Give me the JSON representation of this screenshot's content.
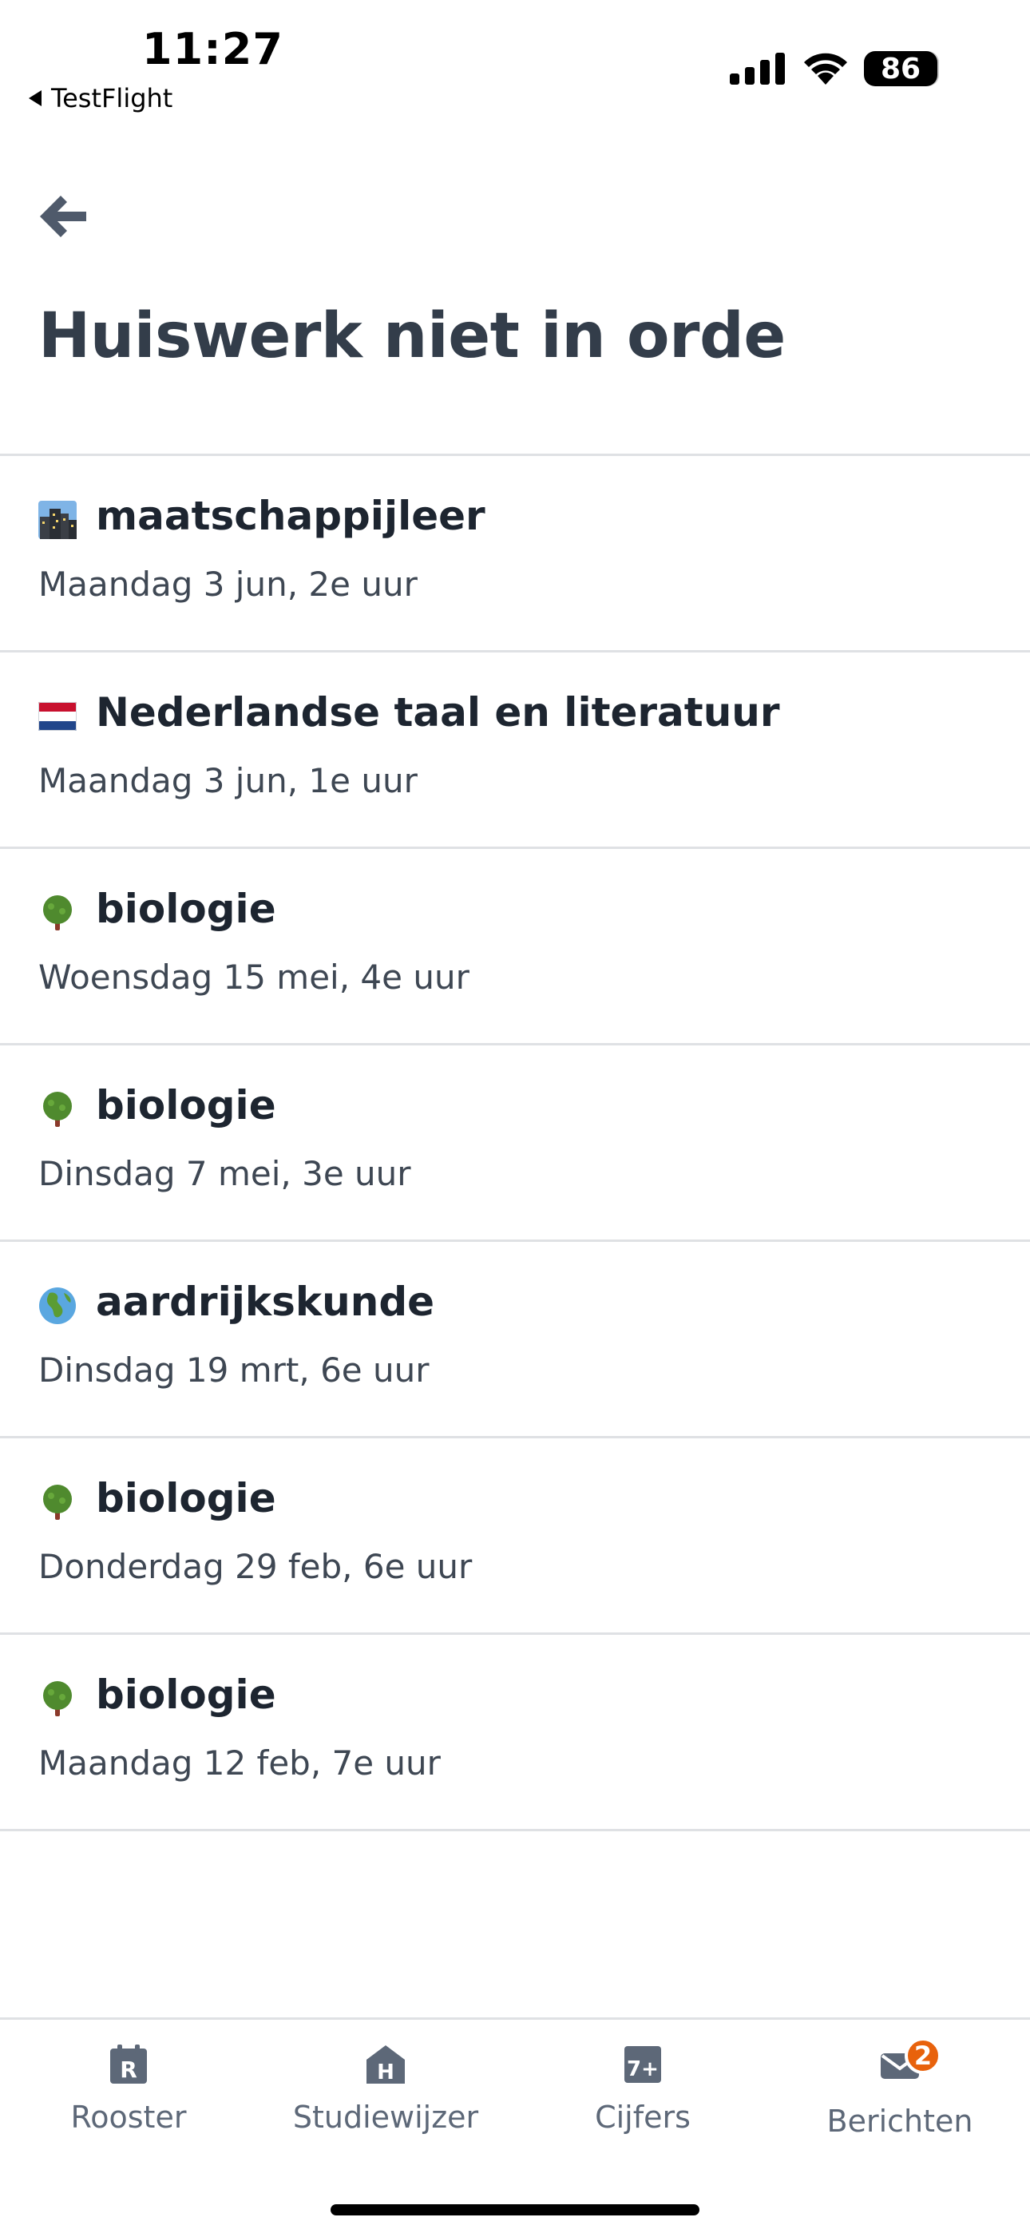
{
  "status_bar": {
    "time": "11:27",
    "back_app": "TestFlight",
    "battery": "86"
  },
  "header": {
    "back_icon": "arrow-left-icon",
    "title": "Huiswerk niet in orde"
  },
  "items": [
    {
      "icon": "cityscape-icon",
      "title": "maatschappijleer",
      "subtitle": "Maandag 3 jun, 2e uur"
    },
    {
      "icon": "flag-netherlands-icon",
      "title": "Nederlandse taal en literatuur",
      "subtitle": "Maandag 3 jun, 1e uur"
    },
    {
      "icon": "tree-icon",
      "title": "biologie",
      "subtitle": "Woensdag 15 mei, 4e uur"
    },
    {
      "icon": "tree-icon",
      "title": "biologie",
      "subtitle": "Dinsdag 7 mei, 3e uur"
    },
    {
      "icon": "globe-icon",
      "title": "aardrijkskunde",
      "subtitle": "Dinsdag 19 mrt, 6e uur"
    },
    {
      "icon": "tree-icon",
      "title": "biologie",
      "subtitle": "Donderdag 29 feb, 6e uur"
    },
    {
      "icon": "tree-icon",
      "title": "biologie",
      "subtitle": "Maandag 12 feb, 7e uur"
    }
  ],
  "tabbar": {
    "tabs": [
      {
        "label": "Rooster",
        "icon": "calendar-r-icon",
        "glyph": "R"
      },
      {
        "label": "Studiewijzer",
        "icon": "house-h-icon",
        "glyph": "H"
      },
      {
        "label": "Cijfers",
        "icon": "grade-7plus-icon",
        "glyph": "7+"
      },
      {
        "label": "Berichten",
        "icon": "envelope-icon",
        "badge": "2"
      }
    ]
  },
  "colors": {
    "title": "#333d4a",
    "tab_icon": "#5d6878",
    "badge": "#e8620c",
    "divider": "#dfe1e4"
  }
}
